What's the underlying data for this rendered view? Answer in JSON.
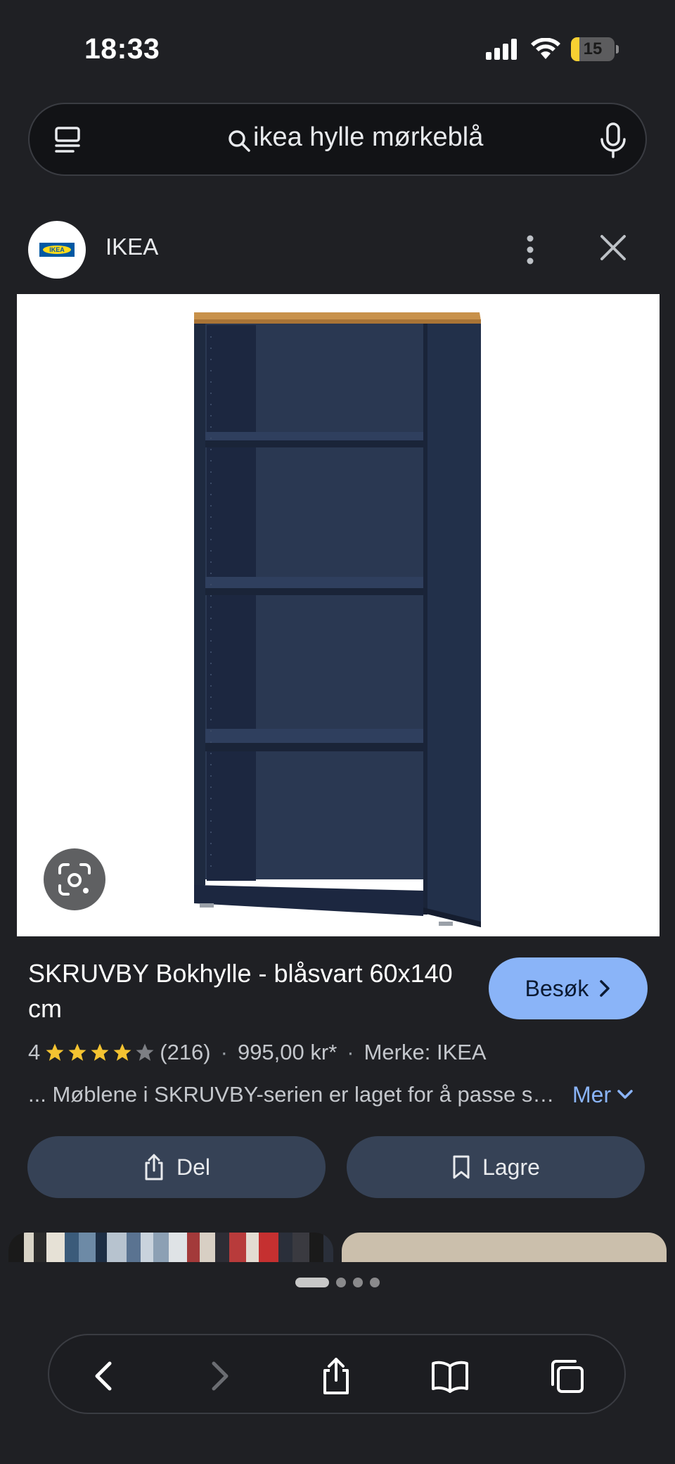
{
  "status_bar": {
    "time": "18:33",
    "battery_level": "15",
    "icons": [
      "signal-icon",
      "wifi-icon",
      "battery-icon"
    ]
  },
  "search": {
    "query": "ikea hylle mørkeblå"
  },
  "source": {
    "name": "IKEA",
    "logo_text": "IKEA"
  },
  "product": {
    "title": "SKRUVBY Bokhylle - blåsvart 60x140 cm",
    "visit_label": "Besøk",
    "rating_value": "4",
    "rating_stars": 4,
    "review_count": "(216)",
    "separator": "·",
    "price": "995,00 kr*",
    "brand": "Merke: IKEA",
    "description": "... Møblene i SKRUVBY-serien er laget for å passe sammen",
    "more_label": "Mer",
    "share_label": "Del",
    "save_label": "Lagre"
  },
  "pager": {
    "total": 4,
    "active_index": 0
  },
  "colors": {
    "background": "#1f2024",
    "accent": "#8ab4f8",
    "button_bg": "#364256",
    "star": "#f4c331",
    "shelf_blue": "#25324b",
    "shelf_top": "#c8914a"
  }
}
